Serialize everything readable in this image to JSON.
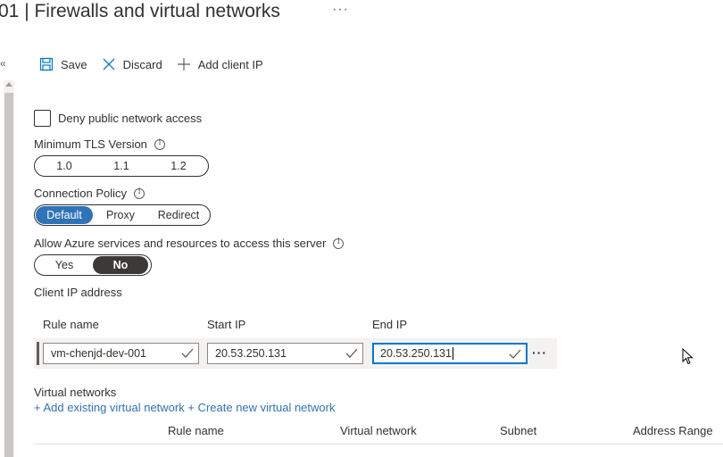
{
  "header": {
    "title": "01 | Firewalls and virtual networks",
    "more": "···"
  },
  "toolbar": {
    "save": "Save",
    "discard": "Discard",
    "add_client_ip": "Add client IP"
  },
  "deny_public": {
    "label": "Deny public network access",
    "checked": false
  },
  "tls": {
    "label": "Minimum TLS Version",
    "options": [
      "1.0",
      "1.1",
      "1.2"
    ],
    "selected": null
  },
  "connection_policy": {
    "label": "Connection Policy",
    "options": [
      "Default",
      "Proxy",
      "Redirect"
    ],
    "selected": "Default"
  },
  "allow_azure": {
    "label": "Allow Azure services and resources to access this server",
    "options": [
      "Yes",
      "No"
    ],
    "selected": "No"
  },
  "client_ip": {
    "label": "Client IP address",
    "columns": [
      "Rule name",
      "Start IP",
      "End IP"
    ],
    "row": {
      "rule_name": "vm-chenjd-dev-001",
      "start_ip": "20.53.250.131",
      "end_ip": "20.53.250.131",
      "more": "···"
    }
  },
  "virtual_networks": {
    "label": "Virtual networks",
    "add_existing": "+ Add existing virtual network",
    "create_new": "+ Create new virtual network",
    "columns": [
      "Rule name",
      "Virtual network",
      "Subnet",
      "Address Range"
    ]
  },
  "colors": {
    "accent": "#2f73b8",
    "focus": "#0078d4",
    "selected_dark": "#3b3a39"
  },
  "icons": {
    "save": "save-icon",
    "discard": "close-icon",
    "add": "plus-icon",
    "info": "info-icon",
    "collapse": "double-chevron-left-icon",
    "checkmark": "checkmark-icon"
  }
}
